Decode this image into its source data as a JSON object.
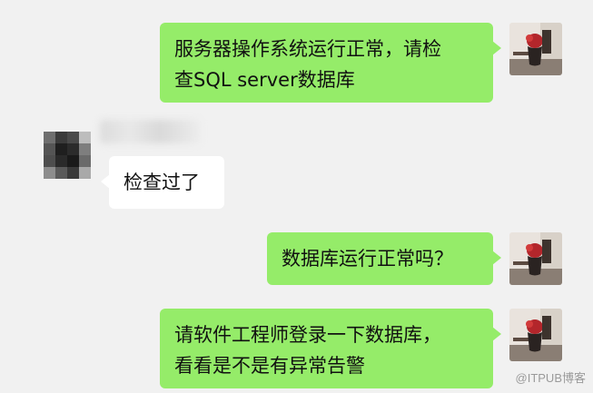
{
  "messages": [
    {
      "sender": "me",
      "lines": [
        "服务器操作系统运行正常，请检",
        "查SQL server数据库"
      ]
    },
    {
      "sender": "other",
      "text": "检查过了"
    },
    {
      "sender": "me",
      "text": "数据库运行正常吗？"
    },
    {
      "sender": "me",
      "lines": [
        "请软件工程师登录一下数据库，",
        "看看是不是有异常告警"
      ]
    }
  ],
  "watermark": "@ITPUB博客",
  "colors": {
    "background": "#f1f1f1",
    "my_bubble": "#95ec69",
    "other_bubble": "#ffffff"
  },
  "icons": {
    "my_avatar": "flower-vase-photo-avatar",
    "other_avatar": "pixelated-avatar"
  }
}
